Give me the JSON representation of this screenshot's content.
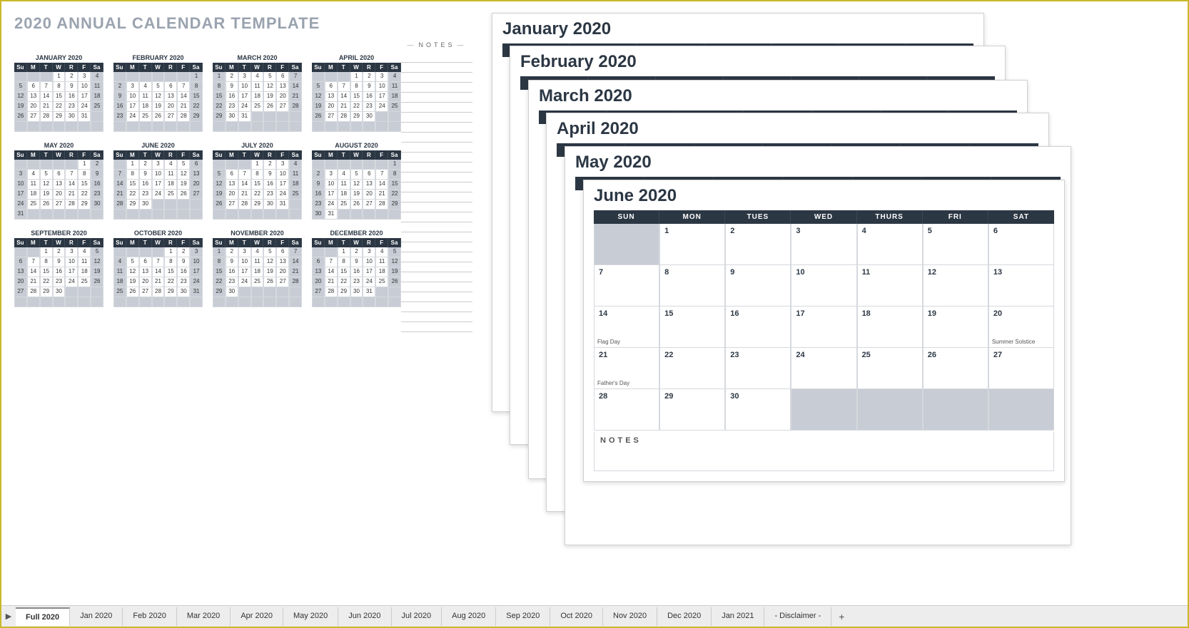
{
  "annual_title": "2020 ANNUAL CALENDAR TEMPLATE",
  "notes_label": "NOTES",
  "day_headers_short": [
    "Su",
    "M",
    "T",
    "W",
    "R",
    "F",
    "Sa"
  ],
  "day_headers_long": [
    "SUN",
    "MON",
    "TUES",
    "WED",
    "THURS",
    "FRI",
    "SAT"
  ],
  "months": [
    {
      "name": "JANUARY 2020",
      "start": 3,
      "days": 31
    },
    {
      "name": "FEBRUARY 2020",
      "start": 6,
      "days": 29
    },
    {
      "name": "MARCH 2020",
      "start": 0,
      "days": 31
    },
    {
      "name": "APRIL 2020",
      "start": 3,
      "days": 30
    },
    {
      "name": "MAY 2020",
      "start": 5,
      "days": 31
    },
    {
      "name": "JUNE 2020",
      "start": 1,
      "days": 30
    },
    {
      "name": "JULY 2020",
      "start": 3,
      "days": 31
    },
    {
      "name": "AUGUST 2020",
      "start": 6,
      "days": 31
    },
    {
      "name": "SEPTEMBER 2020",
      "start": 2,
      "days": 30
    },
    {
      "name": "OCTOBER 2020",
      "start": 4,
      "days": 31
    },
    {
      "name": "NOVEMBER 2020",
      "start": 0,
      "days": 30
    },
    {
      "name": "DECEMBER 2020",
      "start": 2,
      "days": 31
    }
  ],
  "stacked_sheets": [
    "January 2020",
    "February 2020",
    "March 2020",
    "April 2020",
    "May 2020",
    "June 2020"
  ],
  "june": {
    "title": "June 2020",
    "start": 1,
    "days": 30,
    "events": {
      "14": "Flag Day",
      "20": "Summer Solstice",
      "21": "Father's Day"
    },
    "notes_label": "NOTES"
  },
  "tabs": [
    "Full 2020",
    "Jan 2020",
    "Feb 2020",
    "Mar 2020",
    "Apr 2020",
    "May 2020",
    "Jun 2020",
    "Jul 2020",
    "Aug 2020",
    "Sep 2020",
    "Oct 2020",
    "Nov 2020",
    "Dec 2020",
    "Jan 2021",
    "- Disclaimer -"
  ],
  "active_tab": 0
}
